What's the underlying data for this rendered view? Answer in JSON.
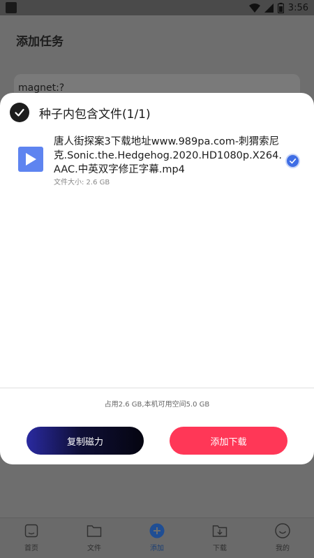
{
  "status_bar": {
    "time": "3:56"
  },
  "page": {
    "title": "添加任务",
    "input_value": "magnet:?"
  },
  "dialog": {
    "title": "种子内包含文件(1/1)",
    "files": [
      {
        "name": "唐人街探案3下载地址www.989pa.com-刺猬索尼克.Sonic.the.Hedgehog.2020.HD1080p.X264.AAC.中英双字修正字幕.mp4",
        "size": "文件大小: 2.6 GB",
        "selected": true
      }
    ],
    "space_info": "占用2.6 GB,本机可用空间5.0 GB",
    "copy_button": "复制磁力",
    "add_button": "添加下载"
  },
  "bottom_nav": {
    "items": [
      {
        "label": "首页",
        "icon": "home-icon"
      },
      {
        "label": "文件",
        "icon": "folder-icon"
      },
      {
        "label": "添加",
        "icon": "add-icon",
        "active": true
      },
      {
        "label": "下载",
        "icon": "download-icon"
      },
      {
        "label": "我的",
        "icon": "smile-icon"
      }
    ]
  },
  "colors": {
    "accent_blue": "#3f6ee5",
    "add_button": "#ff3757",
    "copy_button_dark": "#050510"
  }
}
